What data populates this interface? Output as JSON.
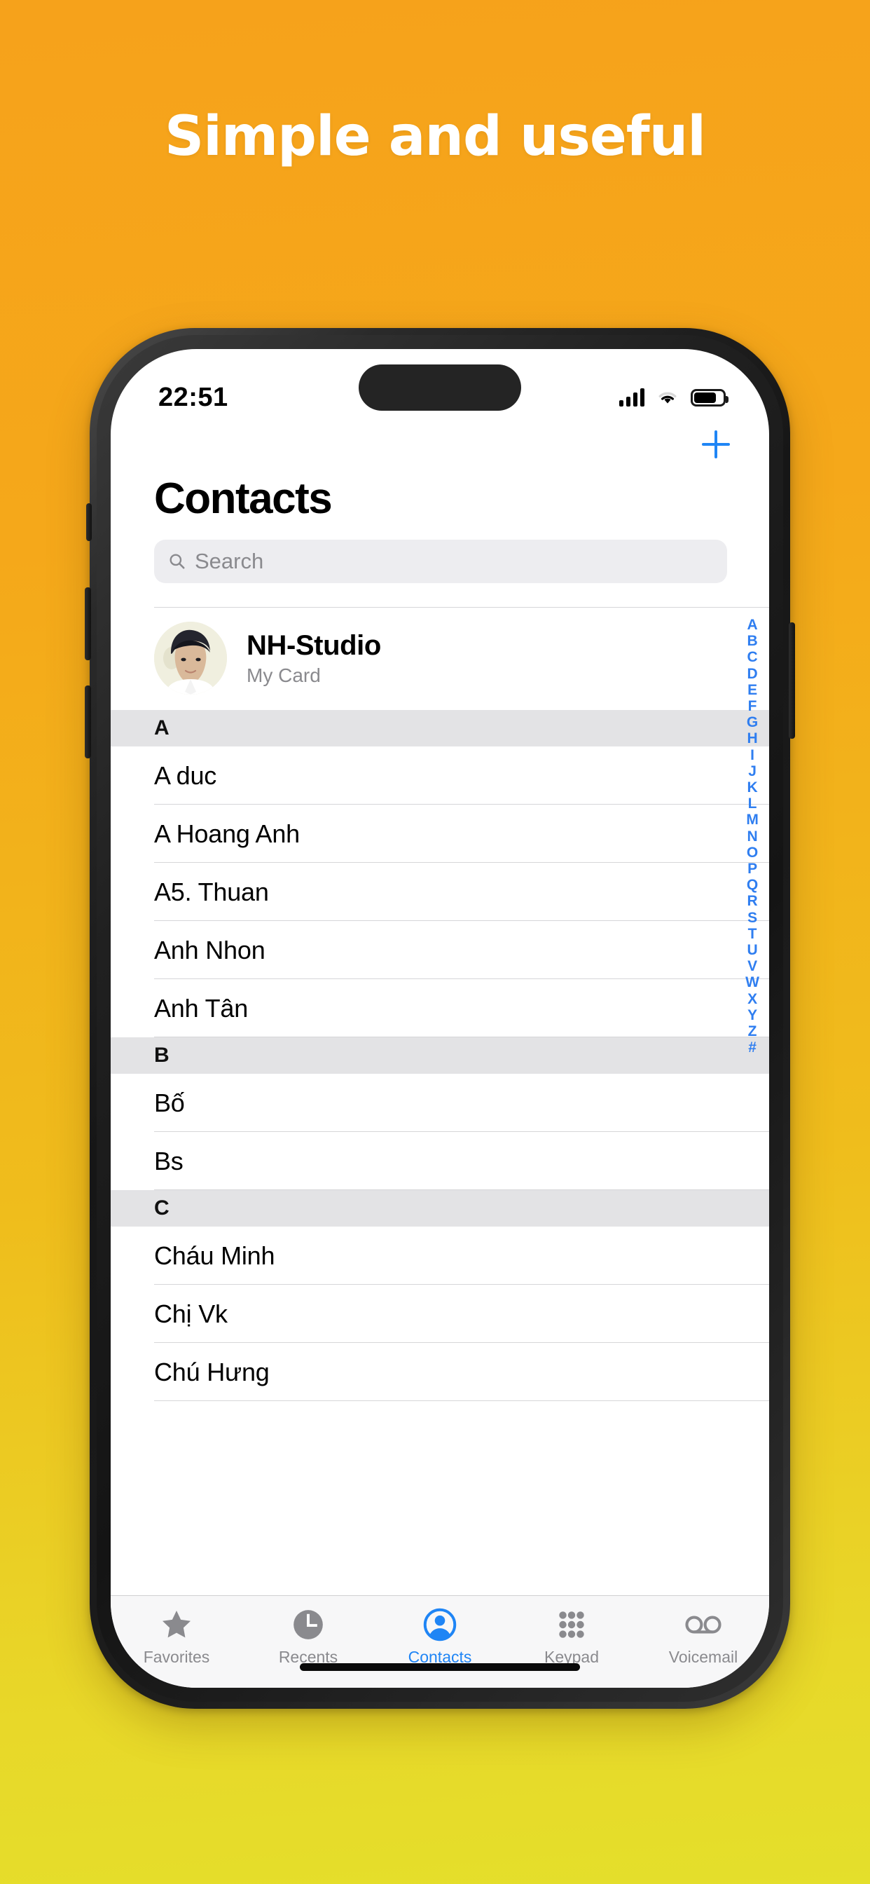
{
  "headline": "Simple and useful",
  "colors": {
    "bg_top": "#F6A21B",
    "bg_bottom": "#E4DF2B",
    "accent_blue": "#1F85F5",
    "index_blue": "#2F7EF0",
    "section_header_bg": "#E3E3E5",
    "search_bg": "#EDEDF0",
    "tabbar_bg": "#F7F7F8",
    "tab_inactive": "#8A8A8E"
  },
  "status_bar": {
    "time": "22:51",
    "cellular_icon": "signal-bars-icon",
    "wifi_icon": "wifi-icon",
    "battery_icon": "battery-icon"
  },
  "nav": {
    "add_icon": "plus-icon",
    "add_label": "+"
  },
  "header": {
    "title": "Contacts"
  },
  "search": {
    "placeholder": "Search",
    "value": "",
    "icon": "search-icon"
  },
  "my_card": {
    "name": "NH-Studio",
    "subtitle": "My Card",
    "avatar": "contact-photo-avatar"
  },
  "sections": [
    {
      "letter": "A",
      "contacts": [
        "A duc",
        "A Hoang Anh",
        "A5. Thuan",
        "Anh Nhon",
        "Anh Tân"
      ]
    },
    {
      "letter": "B",
      "contacts": [
        "Bố",
        "Bs"
      ]
    },
    {
      "letter": "C",
      "contacts": [
        "Cháu Minh",
        "Chị Vk",
        "Chú Hưng"
      ]
    }
  ],
  "index_letters": [
    "A",
    "B",
    "C",
    "D",
    "E",
    "F",
    "G",
    "H",
    "I",
    "J",
    "K",
    "L",
    "M",
    "N",
    "O",
    "P",
    "Q",
    "R",
    "S",
    "T",
    "U",
    "V",
    "W",
    "X",
    "Y",
    "Z",
    "#"
  ],
  "tabs": [
    {
      "label": "Favorites",
      "icon": "star-icon",
      "active": false
    },
    {
      "label": "Recents",
      "icon": "clock-icon",
      "active": false
    },
    {
      "label": "Contacts",
      "icon": "person-circle-icon",
      "active": true
    },
    {
      "label": "Keypad",
      "icon": "keypad-dots-icon",
      "active": false
    },
    {
      "label": "Voicemail",
      "icon": "voicemail-icon",
      "active": false
    }
  ]
}
